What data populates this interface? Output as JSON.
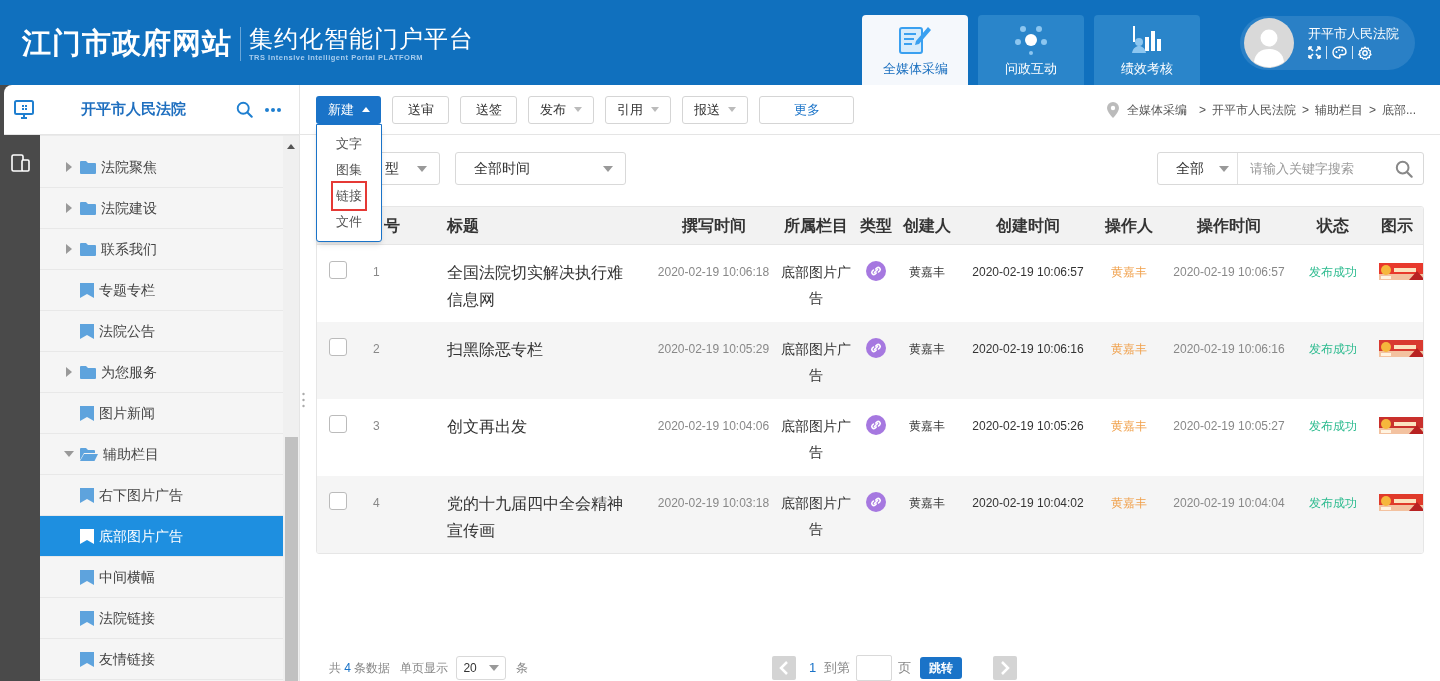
{
  "header": {
    "logo": "江门市政府网站",
    "platform_title": "集约化智能门户平台",
    "platform_subtitle": "TRS Intensive Intelligent Portal PLATFORM"
  },
  "nav_tabs": [
    {
      "label": "全媒体采编",
      "selected": true
    },
    {
      "label": "问政互动",
      "selected": false
    },
    {
      "label": "绩效考核",
      "selected": false
    }
  ],
  "user": {
    "name": "开平市人民法院"
  },
  "sidebar": {
    "title": "开平市人民法院",
    "tree": [
      {
        "label": "法院聚焦",
        "kind": "folder",
        "expanded": false,
        "selected": false
      },
      {
        "label": "法院建设",
        "kind": "folder",
        "expanded": false,
        "selected": false
      },
      {
        "label": "联系我们",
        "kind": "folder",
        "expanded": false,
        "selected": false
      },
      {
        "label": "专题专栏",
        "kind": "leaf",
        "selected": false
      },
      {
        "label": "法院公告",
        "kind": "leaf",
        "selected": false
      },
      {
        "label": "为您服务",
        "kind": "folder",
        "expanded": false,
        "selected": false
      },
      {
        "label": "图片新闻",
        "kind": "leaf",
        "selected": false
      },
      {
        "label": "辅助栏目",
        "kind": "folder",
        "expanded": true,
        "selected": false,
        "children": [
          {
            "label": "右下图片广告",
            "kind": "leaf",
            "selected": false
          },
          {
            "label": "底部图片广告",
            "kind": "leaf",
            "selected": true
          },
          {
            "label": "中间横幅",
            "kind": "leaf",
            "selected": false
          },
          {
            "label": "法院链接",
            "kind": "leaf",
            "selected": false
          },
          {
            "label": "友情链接",
            "kind": "leaf",
            "selected": false
          }
        ]
      }
    ]
  },
  "toolbar": {
    "buttons": [
      {
        "label": "新建",
        "kind": "primary",
        "expanded": true
      },
      {
        "label": "送审",
        "kind": "plain"
      },
      {
        "label": "送签",
        "kind": "plain"
      },
      {
        "label": "发布",
        "kind": "dropdown",
        "expanded": false
      },
      {
        "label": "引用",
        "kind": "dropdown",
        "expanded": false
      },
      {
        "label": "报送",
        "kind": "dropdown",
        "expanded": false
      },
      {
        "label": "更多",
        "kind": "wide"
      }
    ]
  },
  "dropdown_menu": {
    "items": [
      {
        "label": "文字",
        "highlighted": false
      },
      {
        "label": "图集",
        "highlighted": false
      },
      {
        "label": "链接",
        "highlighted": true
      },
      {
        "label": "文件",
        "highlighted": false
      }
    ]
  },
  "breadcrumb": {
    "separator": ">",
    "items": [
      "全媒体采编",
      "开平市人民法院",
      "辅助栏目",
      "底部..."
    ]
  },
  "filters": [
    {
      "value": "型"
    },
    {
      "value": "全部时间"
    }
  ],
  "search": {
    "scope": "全部",
    "placeholder": "请输入关键字搜索"
  },
  "table": {
    "columns": [
      "号",
      "标题",
      "撰写时间",
      "所属栏目",
      "类型",
      "创建人",
      "创建时间",
      "操作人",
      "操作时间",
      "状态",
      "图示"
    ],
    "rows": [
      {
        "checked": false,
        "index": "1",
        "title": "全国法院切实解决执行难信息网",
        "written_time": "2020-02-19 10:06:18",
        "column": "底部图片广告",
        "creator": "黄嘉丰",
        "created_time": "2020-02-19 10:06:57",
        "operator": "黄嘉丰",
        "operated_time": "2020-02-19 10:06:57",
        "status": "发布成功"
      },
      {
        "checked": false,
        "index": "2",
        "title": "扫黑除恶专栏",
        "written_time": "2020-02-19 10:05:29",
        "column": "底部图片广告",
        "creator": "黄嘉丰",
        "created_time": "2020-02-19 10:06:16",
        "operator": "黄嘉丰",
        "operated_time": "2020-02-19 10:06:16",
        "status": "发布成功"
      },
      {
        "checked": false,
        "index": "3",
        "title": "创文再出发",
        "written_time": "2020-02-19 10:04:06",
        "column": "底部图片广告",
        "creator": "黄嘉丰",
        "created_time": "2020-02-19 10:05:26",
        "operator": "黄嘉丰",
        "operated_time": "2020-02-19 10:05:27",
        "status": "发布成功"
      },
      {
        "checked": false,
        "index": "4",
        "title": "党的十九届四中全会精神宣传画",
        "written_time": "2020-02-19 10:03:18",
        "column": "底部图片广告",
        "creator": "黄嘉丰",
        "created_time": "2020-02-19 10:04:02",
        "operator": "黄嘉丰",
        "operated_time": "2020-02-19 10:04:04",
        "status": "发布成功"
      }
    ]
  },
  "pagination": {
    "total_prefix": "共",
    "total": "4",
    "total_suffix": "条数据",
    "page_size_label": "单页显示",
    "page_size": "20",
    "page_size_unit": "条",
    "current_page": "1",
    "goto_label": "到第",
    "goto_unit": "页",
    "goto_button": "跳转"
  }
}
